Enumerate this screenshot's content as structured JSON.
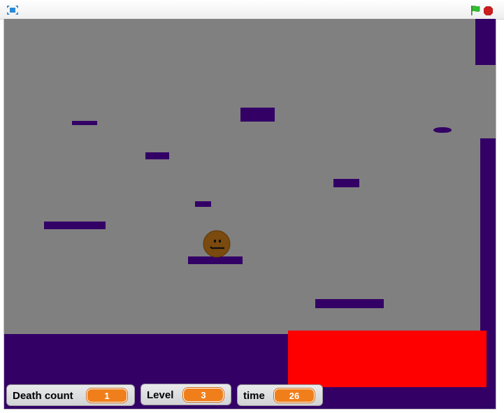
{
  "toolbar": {
    "fullscreen_icon": "fullscreen-icon",
    "green_flag_icon": "green-flag-icon",
    "stop_icon": "stop-sign-icon"
  },
  "stage": {
    "background_color": "#808080",
    "platform_color": "#330066",
    "hazard_color": "#ff0000",
    "player_color": "#7a4a0e"
  },
  "monitors": {
    "death_count": {
      "label": "Death count",
      "value": "1"
    },
    "level": {
      "label": "Level",
      "value": "3"
    },
    "time": {
      "label": "time",
      "value": "26"
    }
  },
  "colors": {
    "monitor_value_bg": "#f07f1b",
    "flag_green": "#2fbf2f",
    "stop_red": "#cc1e1e"
  }
}
